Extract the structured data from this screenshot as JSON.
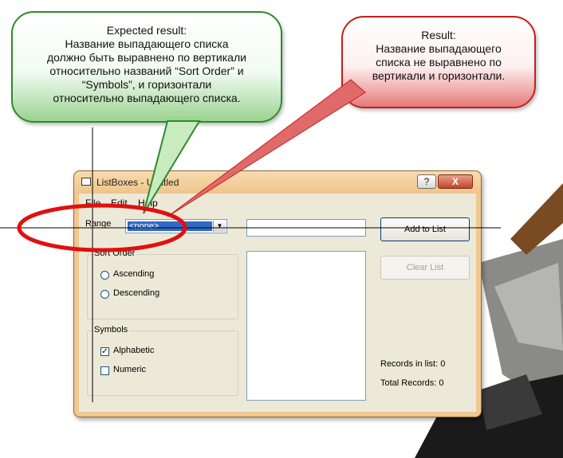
{
  "callouts": {
    "expected": {
      "title": "Expected result:",
      "line1": "Название выпадающего списка",
      "line2": "должно быть выравнено по вертикали",
      "line3": "относительно названий “Sort Order” и",
      "line4": "“Symbols”,  и горизонтали",
      "line5": "относительно выпадающего списка."
    },
    "result": {
      "title": "Result:",
      "line1": "Название выпадающего",
      "line2": "списка не выравнено по",
      "line3": "вертикали и горизонтали."
    }
  },
  "window": {
    "title": "ListBoxes - Untitled",
    "help_button": "?",
    "close_button": "X"
  },
  "menu": [
    "File",
    "Edit",
    "Help"
  ],
  "form": {
    "range_label": "Range",
    "range_selected": "<none>",
    "text_input_value": "",
    "add_button": "Add to List",
    "clear_button": "Clear List",
    "sort_order": {
      "caption": "Sort Order",
      "ascending": "Ascending",
      "descending": "Descending"
    },
    "symbols": {
      "caption": "Symbols",
      "alphabetic": "Alphabetic",
      "numeric": "Numeric",
      "alphabetic_checked": true,
      "numeric_checked": false
    },
    "records_in_list": "Records in list: 0",
    "total_records": "Total Records: 0"
  },
  "colors": {
    "expected_border": "#2f8a2f",
    "result_border": "#c81d1d",
    "highlight_ellipse": "#e01010"
  }
}
